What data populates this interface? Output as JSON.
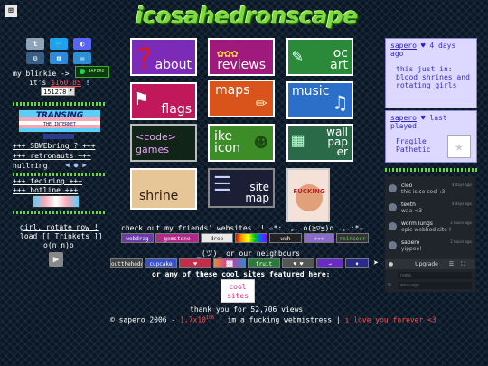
{
  "header": {
    "title": "icosahedronscape",
    "corner_logo": "⊞"
  },
  "social": [
    {
      "name": "tumblr",
      "glyph": "t",
      "color": "#8ea4b8"
    },
    {
      "name": "twitter",
      "glyph": "🐦",
      "color": "#1da1f2"
    },
    {
      "name": "discord",
      "glyph": "◐",
      "color": "#5865f2"
    },
    {
      "name": "steam",
      "glyph": "⚙",
      "color": "#3a5f86"
    },
    {
      "name": "mastodon",
      "glyph": "m",
      "color": "#2f8ad8"
    },
    {
      "name": "email",
      "glyph": "✉",
      "color": "#2d8fd6"
    }
  ],
  "left": {
    "blinkie": "my blinkie ->",
    "blinkie_art": "SAPERO",
    "its_prefix": "it's",
    "price": "$160.85",
    "its_suffix": "!",
    "counter": "151278",
    "transing_1": "TRANSING",
    "transing_2": "THE INTERNET",
    "webring_1": "+++ SBWEbring ? +++",
    "webring_2": "+++ retronauts +++",
    "webring_3": "nullring",
    "webring_4": "+++ fediring +++",
    "webring_5": "+++ hotline +++",
    "girl_rotate": "girl, rotate now !",
    "load_trinkets": "load [[ Trinkets ]]",
    "face": "o(n_n)o"
  },
  "tiles": [
    {
      "label": "about",
      "icon": "?",
      "bg": "#7c2ab8"
    },
    {
      "label": "reviews",
      "icon": "✿✿✿",
      "bg": "#a0197c"
    },
    {
      "label": "oc art",
      "icon": "✎",
      "bg": "#2a8a3a"
    },
    {
      "label": "flags",
      "icon": "⚑",
      "bg": "#c0185a"
    },
    {
      "label": "maps",
      "icon": "✏",
      "bg": "#d8541a"
    },
    {
      "label": "music",
      "icon": "♫",
      "bg": "#2b6fc8"
    },
    {
      "label": "<code> games",
      "icon": "",
      "bg": "#112418"
    },
    {
      "label": "ike icon",
      "icon": "☻",
      "bg": "#3c8c28"
    },
    {
      "label": "wall pap er",
      "icon": "▦",
      "bg": "#2a6a48"
    },
    {
      "label": "shrine",
      "icon": "",
      "bg": "#e6c596"
    },
    {
      "label": "site map",
      "icon": "☰",
      "bg": "#1a1f36"
    },
    {
      "label": "FUCKING RICE",
      "icon": "",
      "bg": "#f4e2d8"
    }
  ],
  "status": {
    "user": "sapero",
    "heart": "♥",
    "ago": "4 days ago",
    "body": "this just in: blood shrines and rotating girls"
  },
  "last_played": {
    "user": "sapero",
    "heart": "♥",
    "label": "last played",
    "game": "Fragile Pathetic"
  },
  "chat": {
    "messages": [
      {
        "name": "cleo",
        "time": "4 days ago",
        "msg": "this is so cool :3"
      },
      {
        "name": "teeth",
        "time": "4 days ago",
        "msg": "waa <3"
      },
      {
        "name": "worm lungs",
        "time": "2 hours ago",
        "msg": "epic webbed site !"
      },
      {
        "name": "sapero",
        "time": "2 hours ago",
        "msg": "yippee!"
      }
    ],
    "upgrade": "Upgrade",
    "name_placeholder": "name",
    "message_placeholder": "message"
  },
  "friends": {
    "heading": "check out my friends' websites !! ☆*: .｡. o(≧▽≦)o .｡.:*☆",
    "badges": [
      "webdrag",
      "gemstone",
      "drop",
      "~~~",
      "wuh",
      "✶✶✶",
      "reincorr",
      "~Sweetie"
    ]
  },
  "neighbours": {
    "heading": "_(ツ)_ or our neighbours",
    "badges": [
      "outthehodge",
      "cupcake",
      "♥",
      "▓▓",
      "fruit",
      "♥ ♥",
      "→",
      "♦",
      "♥ ♥"
    ]
  },
  "featured": {
    "heading": "or any of these cool sites featured here:",
    "site": "cool sites"
  },
  "footer": {
    "views_text": "thank you for 52,706 views",
    "copyright_prefix": "© sapero 2006 -",
    "exponent_base": "1.7x10",
    "exponent": "106",
    "sep1": "|",
    "webmistress": "im a fucking webmistress",
    "sep2": "|",
    "love": "i love you forever <3"
  },
  "colors": {
    "accent_green": "#67d93f",
    "title_green": "#7dd940",
    "red": "#ff4d4d",
    "box_purple": "#dcd8ff"
  }
}
